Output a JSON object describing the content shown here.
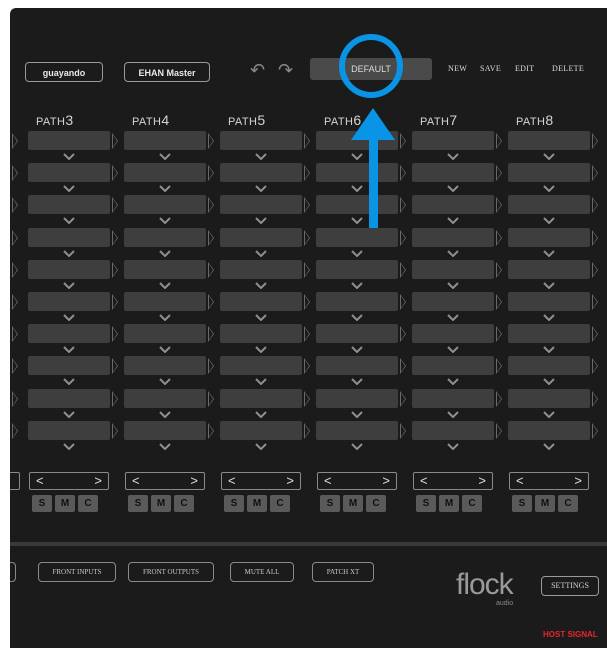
{
  "header": {
    "user_label": "guayando",
    "device_label": "EHAN Master",
    "undo_icon": "undo-icon",
    "redo_icon": "redo-icon",
    "preset_name": "DEFAULT",
    "new_label": "NEW",
    "save_label": "SAVE",
    "edit_label": "EDIT",
    "delete_label": "DELETE"
  },
  "paths": [
    {
      "prefix": "PATH",
      "num": "3"
    },
    {
      "prefix": "PATH",
      "num": "4"
    },
    {
      "prefix": "PATH",
      "num": "5"
    },
    {
      "prefix": "PATH",
      "num": "6"
    },
    {
      "prefix": "PATH",
      "num": "7"
    },
    {
      "prefix": "PATH",
      "num": "8"
    }
  ],
  "slot_rows": 10,
  "nav": {
    "prev": "<",
    "next": ">"
  },
  "smc": [
    "S",
    "M",
    "C"
  ],
  "footer": {
    "front_inputs": "FRONT INPUTS",
    "front_outputs": "FRONT OUTPUTS",
    "mute_all": "MUTE ALL",
    "patch_xt": "PATCH XT",
    "logo": "flock",
    "logo_sub": "audio",
    "settings": "SETTINGS",
    "host_signal": "HOST SIGNAL"
  },
  "colors": {
    "background": "#1b1b1b",
    "slot": "#3e3e3e",
    "annotation": "#0a94e6",
    "host_signal": "#e8252c"
  }
}
